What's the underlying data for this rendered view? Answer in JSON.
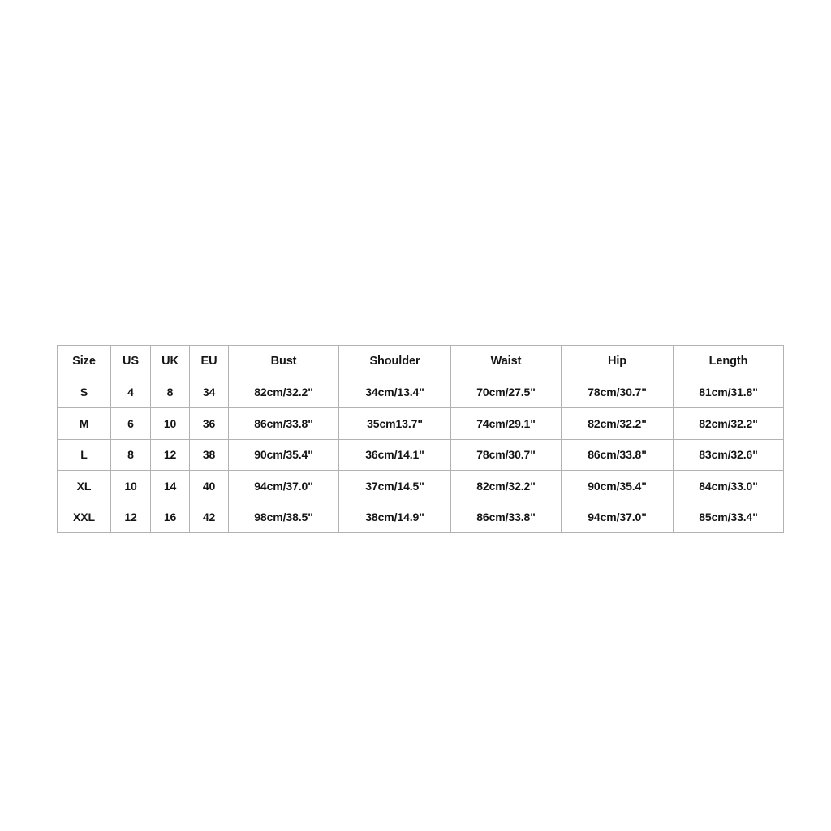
{
  "table": {
    "columns": [
      "Size",
      "US",
      "UK",
      "EU",
      "Bust",
      "Shoulder",
      "Waist",
      "Hip",
      "Length"
    ],
    "rows": [
      {
        "size": "S",
        "us": "4",
        "uk": "8",
        "eu": "34",
        "bust": "82cm/32.2\"",
        "shoulder": "34cm/13.4\"",
        "waist": "70cm/27.5\"",
        "hip": "78cm/30.7\"",
        "length": "81cm/31.8\""
      },
      {
        "size": "M",
        "us": "6",
        "uk": "10",
        "eu": "36",
        "bust": "86cm/33.8\"",
        "shoulder": "35cm13.7\"",
        "waist": "74cm/29.1\"",
        "hip": "82cm/32.2\"",
        "length": "82cm/32.2\""
      },
      {
        "size": "L",
        "us": "8",
        "uk": "12",
        "eu": "38",
        "bust": "90cm/35.4\"",
        "shoulder": "36cm/14.1\"",
        "waist": "78cm/30.7\"",
        "hip": "86cm/33.8\"",
        "length": "83cm/32.6\""
      },
      {
        "size": "XL",
        "us": "10",
        "uk": "14",
        "eu": "40",
        "bust": "94cm/37.0\"",
        "shoulder": "37cm/14.5\"",
        "waist": "82cm/32.2\"",
        "hip": "90cm/35.4\"",
        "length": "84cm/33.0\""
      },
      {
        "size": "XXL",
        "us": "12",
        "uk": "16",
        "eu": "42",
        "bust": "98cm/38.5\"",
        "shoulder": "38cm/14.9\"",
        "waist": "86cm/33.8\"",
        "hip": "94cm/37.0\"",
        "length": "85cm/33.4\""
      }
    ]
  },
  "colors": {
    "background": "#ffffff",
    "border": "#b2b2b2",
    "text": "#151515"
  }
}
